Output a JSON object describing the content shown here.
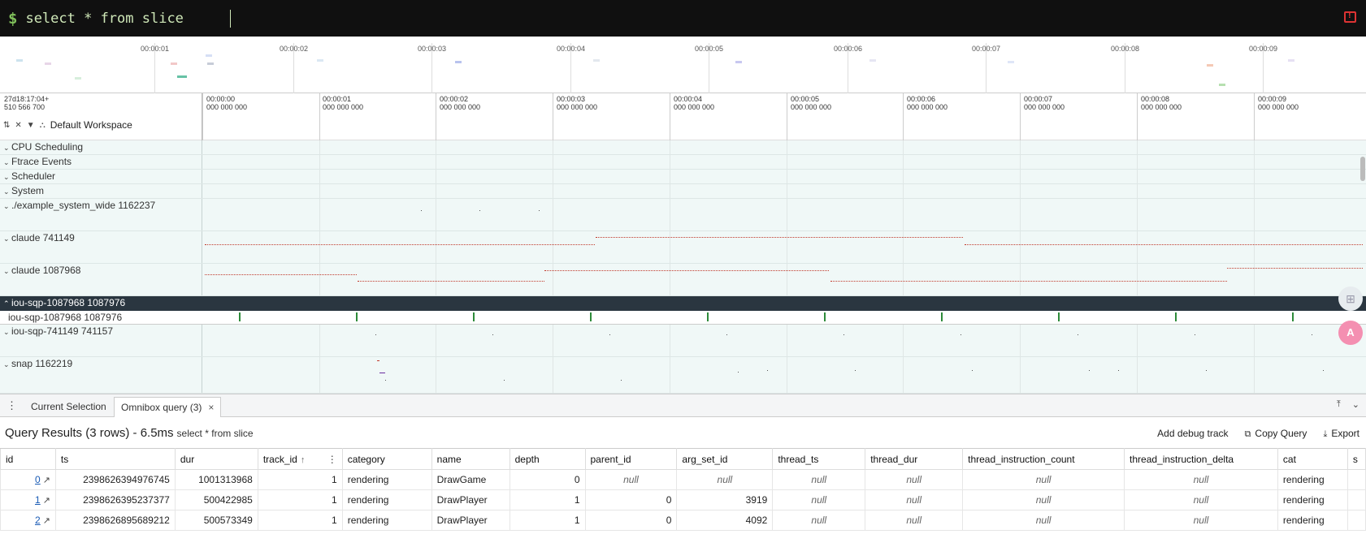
{
  "omnibox": {
    "prompt": "$",
    "query": "select * from slice"
  },
  "overview": {
    "ticks": [
      "00:00:01",
      "00:00:02",
      "00:00:03",
      "00:00:04",
      "00:00:05",
      "00:00:06",
      "00:00:07",
      "00:00:08",
      "00:00:09"
    ]
  },
  "timeline": {
    "origin": "27d18:17:04+\n510 566 700",
    "workspace": "Default Workspace",
    "ticks": [
      "00:00:00\n000 000 000",
      "00:00:01\n000 000 000",
      "00:00:02\n000 000 000",
      "00:00:03\n000 000 000",
      "00:00:04\n000 000 000",
      "00:00:05\n000 000 000",
      "00:00:06\n000 000 000",
      "00:00:07\n000 000 000",
      "00:00:08\n000 000 000",
      "00:00:09\n000 000 000"
    ]
  },
  "tracks": {
    "cpu_scheduling": "CPU Scheduling",
    "ftrace_events": "Ftrace Events",
    "scheduler": "Scheduler",
    "system": "System",
    "example": "./example_system_wide 1162237",
    "claude_741149": "claude 741149",
    "claude_1087968": "claude 1087968",
    "iou_group": "iou-sqp-1087968 1087976",
    "iou_sub": "iou-sqp-1087968 1087976",
    "iou_741149": "iou-sqp-741149 741157",
    "snap": "snap 1162219"
  },
  "tabs": {
    "current_selection": "Current Selection",
    "omnibox_query": "Omnibox query (3)",
    "close": "×"
  },
  "results": {
    "title": "Query Results (3 rows) - 6.5ms",
    "query": "select * from slice",
    "add_debug_track": "Add debug track",
    "copy_query": "Copy Query",
    "export": "Export",
    "columns": [
      "id",
      "ts",
      "dur",
      "track_id",
      "category",
      "name",
      "depth",
      "parent_id",
      "arg_set_id",
      "thread_ts",
      "thread_dur",
      "thread_instruction_count",
      "thread_instruction_delta",
      "cat",
      "s"
    ],
    "rows": [
      {
        "id": "0",
        "ts": "2398626394976745",
        "dur": "1001313968",
        "track_id": "1",
        "category": "rendering",
        "name": "DrawGame",
        "depth": "0",
        "parent_id": "null",
        "arg_set_id": "null",
        "thread_ts": "null",
        "thread_dur": "null",
        "thread_instruction_count": "null",
        "thread_instruction_delta": "null",
        "cat": "rendering"
      },
      {
        "id": "1",
        "ts": "2398626395237377",
        "dur": "500422985",
        "track_id": "1",
        "category": "rendering",
        "name": "DrawPlayer",
        "depth": "1",
        "parent_id": "0",
        "arg_set_id": "3919",
        "thread_ts": "null",
        "thread_dur": "null",
        "thread_instruction_count": "null",
        "thread_instruction_delta": "null",
        "cat": "rendering"
      },
      {
        "id": "2",
        "ts": "2398626895689212",
        "dur": "500573349",
        "track_id": "1",
        "category": "rendering",
        "name": "DrawPlayer",
        "depth": "1",
        "parent_id": "0",
        "arg_set_id": "4092",
        "thread_ts": "null",
        "thread_dur": "null",
        "thread_instruction_count": "null",
        "thread_instruction_delta": "null",
        "cat": "rendering"
      }
    ]
  },
  "colors": {
    "omnibox_bg": "#101010",
    "prompt": "#7fbf5a",
    "track_bg": "#f0f8f7",
    "slice": "#c0392b",
    "marker": "#2e8b3a",
    "group_bg": "#2a3640"
  }
}
